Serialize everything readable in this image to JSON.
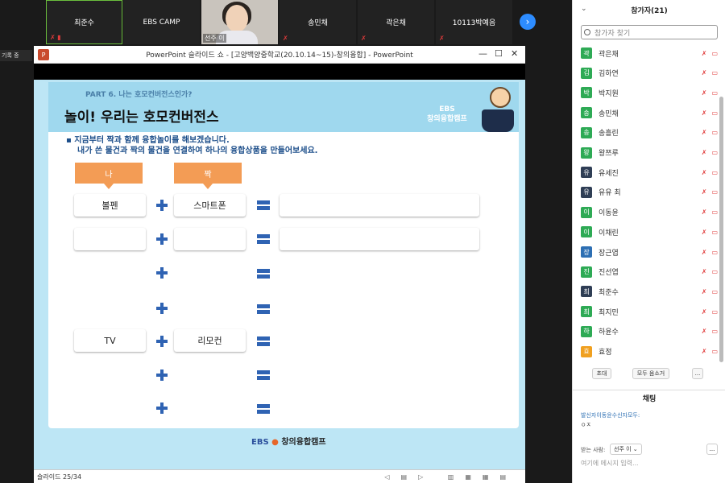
{
  "gallery": {
    "tiles": [
      "최준수",
      "EBS CAMP",
      "송민채",
      "곽은채",
      "10113박예음"
    ],
    "video_name": "선주 이",
    "next": "›"
  },
  "side_button": "기록 중",
  "ppt": {
    "icon": "P",
    "title": "PowerPoint 슬라이드 쇼 - [고양백양중학교(20.10.14~15)-창의융합] - PowerPoint",
    "controls": [
      "—",
      "☐",
      "✕"
    ],
    "slide": {
      "part": "PART 6. 나는 호모컨버전스인가?",
      "title": "놀이! 우리는 호모컨버전스",
      "badge_line1": "EBS",
      "badge_line2": "창의융합캠프",
      "instruction_line1": "▪ 지금부터 짝과 함께 융합놀이를 해보겠습니다.",
      "instruction_line2": "내가 쓴 물건과 짝의 물건을 연결하여 하나의 융합상품을 만들어보세요.",
      "tag_me": "나",
      "tag_partner": "짝",
      "rows": [
        {
          "me": "볼펜",
          "partner": "스마트폰"
        },
        {
          "me": "",
          "partner": ""
        },
        {
          "me": "",
          "partner": ""
        },
        {
          "me": "",
          "partner": ""
        },
        {
          "me": "TV",
          "partner": "리모컨"
        }
      ],
      "footer_ebs": "EBS",
      "footer_text": "창의융합캠프"
    },
    "status": "슬라이드 25/34"
  },
  "panel": {
    "title": "참가자(21)",
    "search_placeholder": "참가자 찾기",
    "participants": [
      {
        "initial": "곽",
        "name": "곽은채",
        "color": "#2eaa55"
      },
      {
        "initial": "김",
        "name": "김하연",
        "color": "#2eaa55"
      },
      {
        "initial": "박",
        "name": "박지원",
        "color": "#2eaa55"
      },
      {
        "initial": "송",
        "name": "송민채",
        "color": "#2eaa55"
      },
      {
        "initial": "송",
        "name": "송흘린",
        "color": "#2eaa55"
      },
      {
        "initial": "왕",
        "name": "왕쯔루",
        "color": "#2eaa55"
      },
      {
        "initial": "유",
        "name": "유세진",
        "color": "#2f3e55"
      },
      {
        "initial": "유",
        "name": "유유 최",
        "color": "#2f3e55"
      },
      {
        "initial": "이",
        "name": "이동윤",
        "color": "#2eaa55"
      },
      {
        "initial": "이",
        "name": "이채린",
        "color": "#2eaa55"
      },
      {
        "initial": "장",
        "name": "장근엽",
        "color": "#2d6fb3"
      },
      {
        "initial": "진",
        "name": "진선엽",
        "color": "#2eaa55"
      },
      {
        "initial": "최",
        "name": "최준수",
        "color": "#2f3e55"
      },
      {
        "initial": "최",
        "name": "최지민",
        "color": "#2eaa55"
      },
      {
        "initial": "하",
        "name": "하윤수",
        "color": "#2eaa55"
      },
      {
        "initial": "효",
        "name": "효정",
        "color": "#f0a020"
      }
    ],
    "invite": "초대",
    "mute_all": "모두 음소거",
    "more": "...",
    "chat_title": "채팅",
    "chat_from": "발신자이동윤수신자모두:",
    "chat_msg": "ㅇㅈ",
    "send_to_label": "받는 사람:",
    "send_to_value": "선주 이 ⌄",
    "chat_placeholder": "여기에 메시지 입력..."
  }
}
